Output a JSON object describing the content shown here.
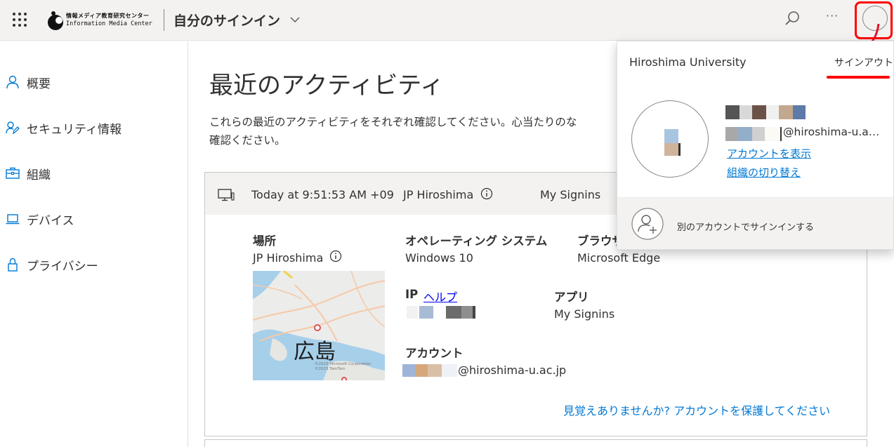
{
  "header": {
    "logo_jp": "情報メディア教育研究センター",
    "logo_en": "Information Media Center",
    "app_title": "自分のサインイン"
  },
  "sidebar": {
    "items": [
      {
        "label": "概要",
        "icon": "person-icon"
      },
      {
        "label": "セキュリティ情報",
        "icon": "security-info-icon"
      },
      {
        "label": "組織",
        "icon": "briefcase-icon"
      },
      {
        "label": "デバイス",
        "icon": "laptop-icon"
      },
      {
        "label": "プライバシー",
        "icon": "lock-icon"
      }
    ]
  },
  "main": {
    "title": "最近のアクティビティ",
    "description": "これらの最近のアクティビティをそれぞれ確認してください。心当たりのな",
    "description_line2": "確認ください。"
  },
  "activity": {
    "time": "Today at 9:51:53 AM +09",
    "location": "JP Hiroshima",
    "app": "My Signins",
    "location_label": "場所",
    "location_value": "JP Hiroshima",
    "os_label": "オペレーティング システム",
    "os_value": "Windows 10",
    "browser_label": "ブラウザ",
    "browser_value": "Microsoft Edge",
    "ip_label": "IP",
    "ip_help": "ヘルプ",
    "app_label": "アプリ",
    "app_value": "My Signins",
    "account_label": "アカウント",
    "account_domain": "@hiroshima-u.ac.jp",
    "map_label": "広島",
    "map_copyright_1": "©2023 Microsoft Corporation",
    "map_copyright_2": "©2023 TomTom",
    "not_you_link": "見覚えありませんか? アカウントを保護してください"
  },
  "account_menu": {
    "org": "Hiroshima University",
    "sign_out": "サインアウト",
    "email_domain": "@hiroshima-u.a…",
    "view_account": "アカウントを表示",
    "switch_org": "組織の切り替え",
    "other_account": "別のアカウントでサインインする"
  },
  "colors": {
    "accent": "#0078d4",
    "highlight": "#ff0000",
    "header_bg": "#f3f2f1"
  }
}
